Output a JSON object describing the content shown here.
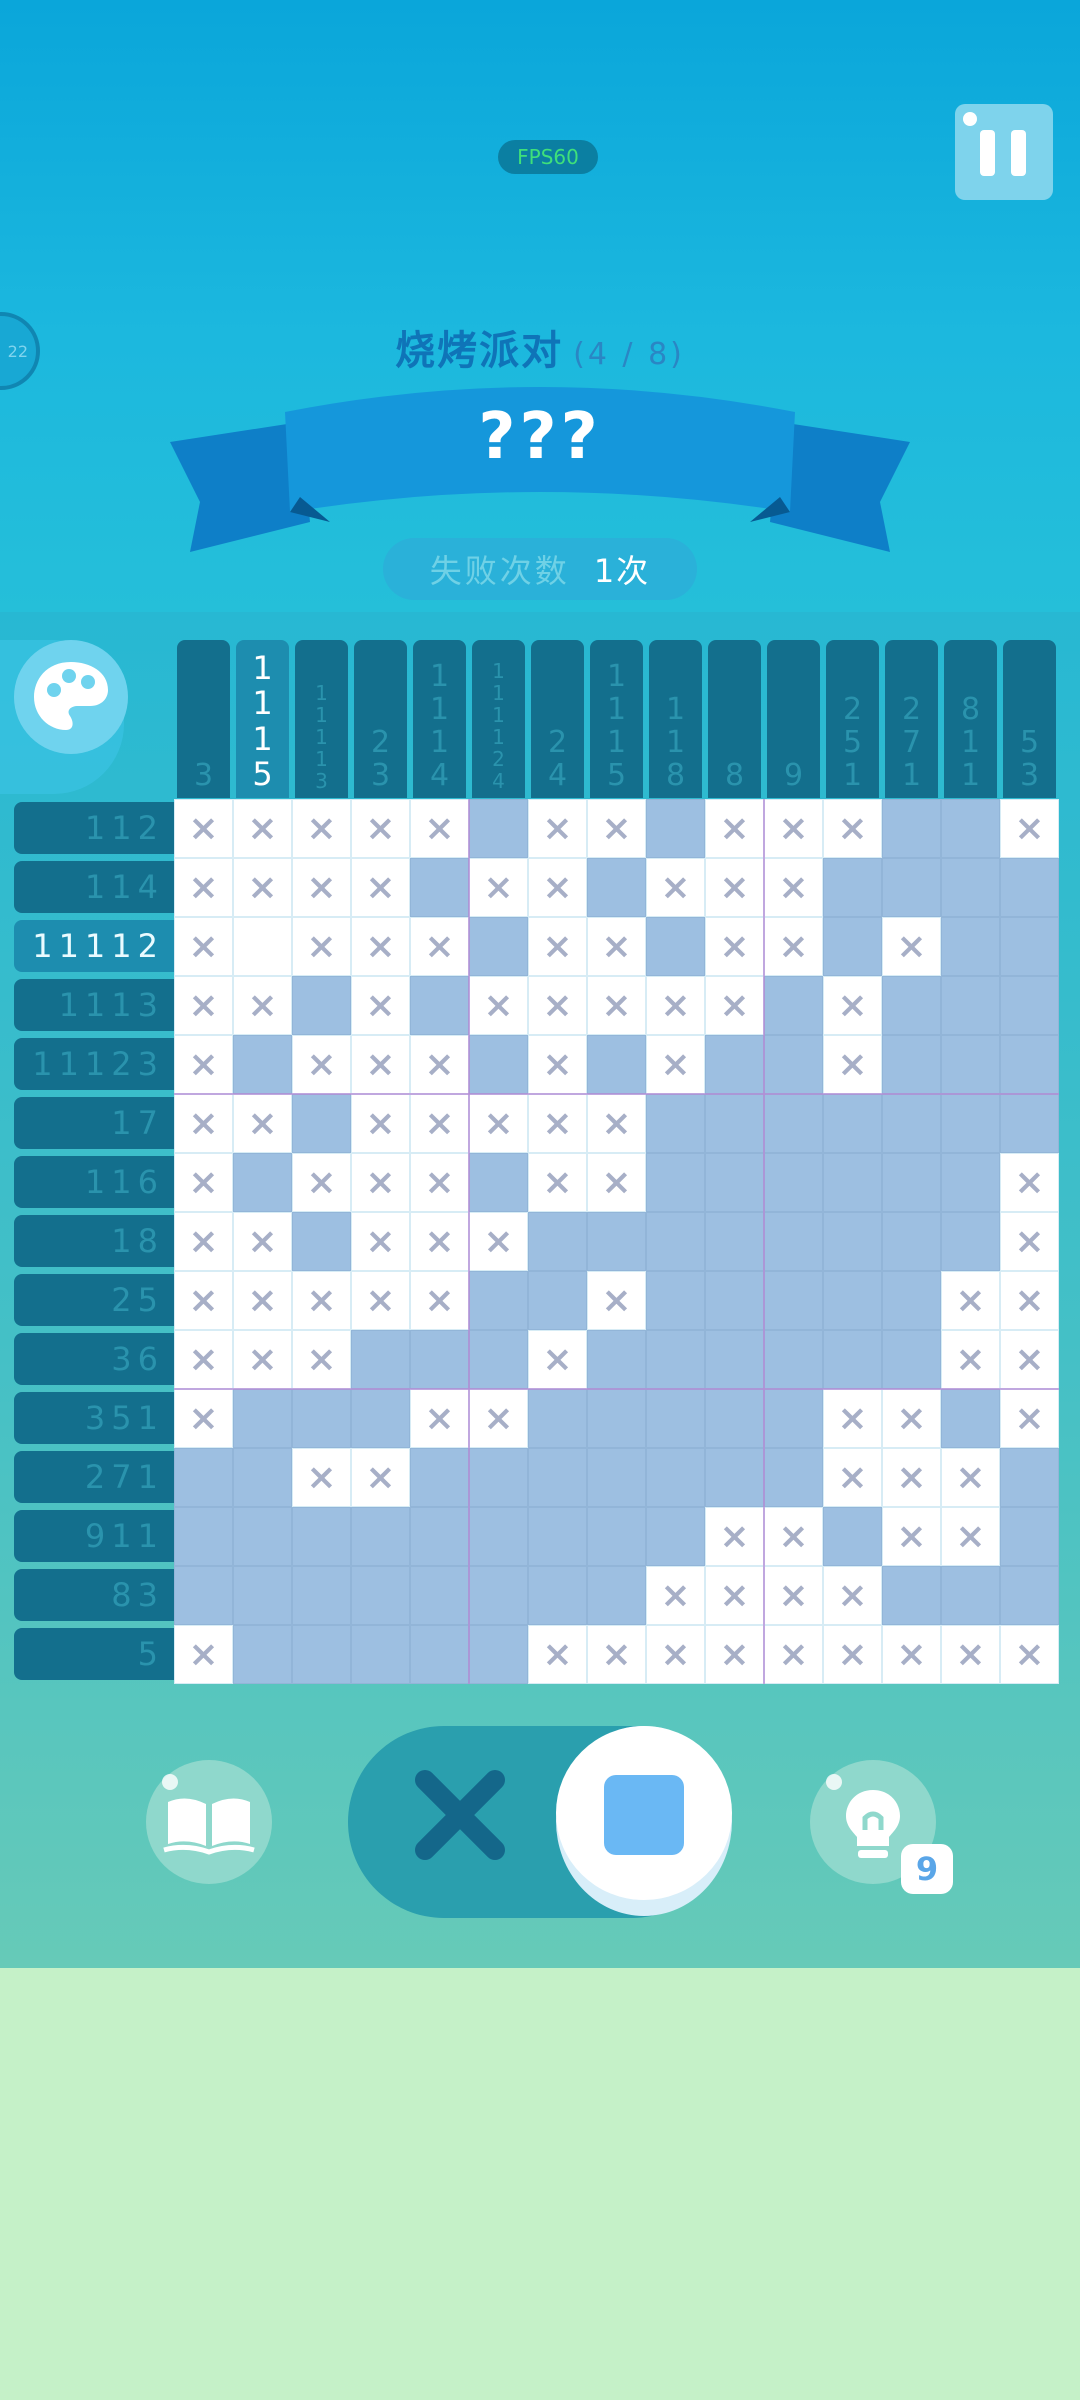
{
  "fps": "FPS60",
  "timer": "22",
  "title": "烧烤派对",
  "progress": "(4 / 8)",
  "banner": "???",
  "fails": {
    "label": "失败次数",
    "value": "1次"
  },
  "column_clues": [
    [
      "3"
    ],
    [
      "1",
      "1",
      "1",
      "5"
    ],
    [
      "1",
      "1",
      "1",
      "1",
      "3"
    ],
    [
      "2",
      "3"
    ],
    [
      "1",
      "1",
      "1",
      "4"
    ],
    [
      "1",
      "1",
      "1",
      "1",
      "2",
      "4"
    ],
    [
      "2",
      "4"
    ],
    [
      "1",
      "1",
      "1",
      "5"
    ],
    [
      "1",
      "1",
      "8"
    ],
    [
      "8"
    ],
    [
      "9"
    ],
    [
      "2",
      "5",
      "1"
    ],
    [
      "2",
      "7",
      "1"
    ],
    [
      "8",
      "1",
      "1"
    ],
    [
      "5",
      "3"
    ]
  ],
  "row_clues": [
    "112",
    "114",
    "11112",
    "1113",
    "11123",
    "17",
    "116",
    "18",
    "25",
    "36",
    "351",
    "271",
    "911",
    "83",
    "5"
  ],
  "grid": [
    "xxxxx.fxx.fxxxff.x",
    "xxxx.fxx.fxxx.fff"
  ],
  "board": [
    "xxxxxFxxFxxxFFx",
    "xxxxFxxFxxxFFFF",
    "x.xxxFxxFxxFxFF",
    "xxFxFxxxxxFxFFF",
    "xFxxxFxFxFFxFFF",
    "xxFxxxxxFFFFFFF",
    "xFxxxFxxFFFFFFx",
    "xxFxxxFFFFFFFFx",
    "xxxxxFFxFFFFFxx",
    "xxxFFFxFFFFFFxx",
    "xFFFxxFFFFFxxFx",
    "FFxxFFFFFFFxxxF",
    "FFFFFFFFFxxFxxF",
    "FFFFFFFFxxxxFFF",
    "xFFFFFxxxxxxxxx"
  ],
  "active_row": 2,
  "active_col": 1,
  "hint_count": "9",
  "colors": {
    "filled": "#9dbfe1",
    "accent": "#0f74b8",
    "fps_text": "#3fe07a"
  }
}
